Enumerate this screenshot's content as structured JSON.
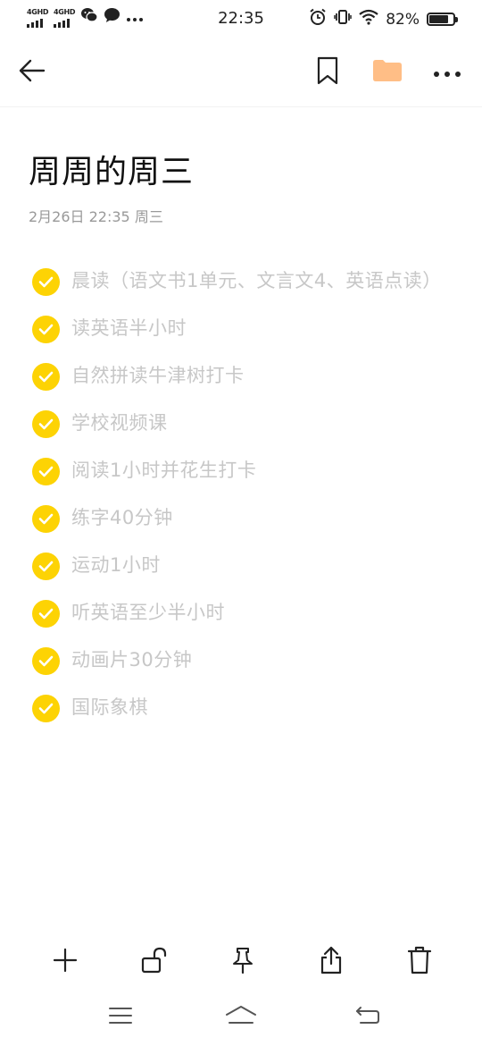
{
  "status_bar": {
    "network_1": "4GHD",
    "network_2": "4GHD",
    "time": "22:35",
    "battery": "82%",
    "battery_level": 0.82,
    "icons": [
      "wechat-icon",
      "message-icon",
      "more-icon",
      "alarm-icon",
      "vibrate-icon",
      "wifi-icon",
      "battery-icon"
    ]
  },
  "toolbar": {
    "icons": [
      "back-arrow-icon",
      "bookmark-icon",
      "folder-icon",
      "more-icon"
    ],
    "folder_color": "#ffbe86"
  },
  "note": {
    "title": "周周的周三",
    "date": "2月26日 22:35 周三",
    "items": [
      {
        "text": "晨读（语文书1单元、文言文4、英语点读）",
        "checked": true
      },
      {
        "text": "读英语半小时",
        "checked": true
      },
      {
        "text": "自然拼读牛津树打卡",
        "checked": true
      },
      {
        "text": "学校视频课",
        "checked": true
      },
      {
        "text": "阅读1小时并花生打卡",
        "checked": true
      },
      {
        "text": "练字40分钟",
        "checked": true
      },
      {
        "text": "运动1小时",
        "checked": true
      },
      {
        "text": "听英语至少半小时",
        "checked": true
      },
      {
        "text": "动画片30分钟",
        "checked": true
      },
      {
        "text": "国际象棋",
        "checked": true
      }
    ],
    "check_color": "#fdd304"
  },
  "bottom_actions": {
    "icons": [
      "add-icon",
      "unlock-icon",
      "pin-icon",
      "share-icon",
      "delete-icon"
    ]
  },
  "nav_bar": {
    "icons": [
      "menu-icon",
      "home-icon",
      "back-icon"
    ]
  }
}
